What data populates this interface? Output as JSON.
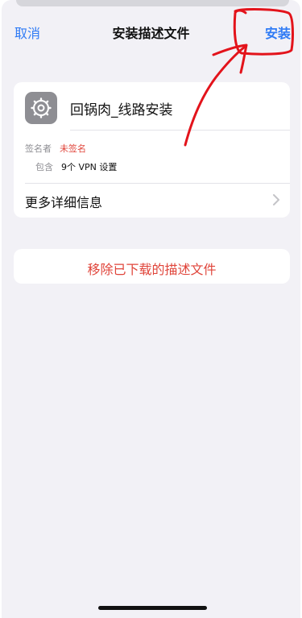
{
  "navbar": {
    "cancel_label": "取消",
    "title": "安装描述文件",
    "install_label": "安装"
  },
  "profile": {
    "name": "回锅肉_线路安装",
    "signer_label": "签名者",
    "signer_value": "未签名",
    "contains_label": "包含",
    "contains_value": "9个 VPN 设置",
    "more_info_label": "更多详细信息",
    "icon": "gear-icon"
  },
  "actions": {
    "remove_label": "移除已下载的描述文件"
  },
  "colors": {
    "accent": "#2f7bf5",
    "destructive": "#e0453b",
    "annotation": "#e3131b",
    "background": "#f2f1f6"
  }
}
